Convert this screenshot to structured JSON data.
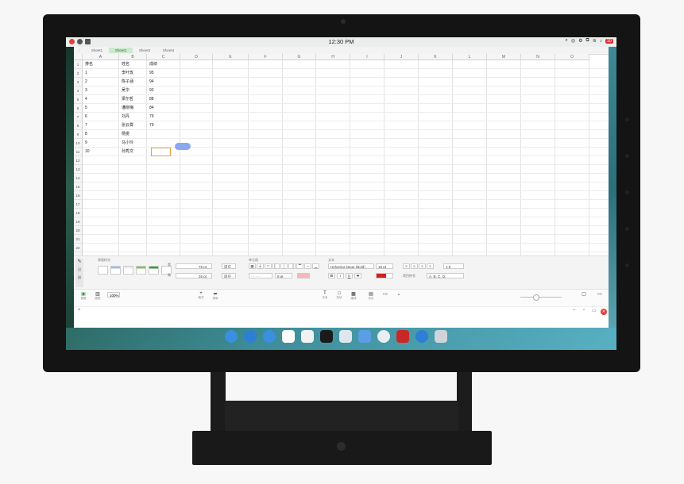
{
  "statusbar": {
    "time": "12:30 PM",
    "battery": "10"
  },
  "sheet_tabs": [
    "Sheet1",
    "Sheet2",
    "Sheet3",
    "Sheet4"
  ],
  "active_tab": 1,
  "columns": [
    "A",
    "B",
    "C",
    "D",
    "E",
    "F",
    "G",
    "H",
    "I",
    "J",
    "K",
    "L",
    "M",
    "N",
    "O"
  ],
  "rows": [
    "1",
    "2",
    "3",
    "4",
    "5",
    "6",
    "7",
    "8",
    "9",
    "10",
    "11",
    "12",
    "13",
    "14",
    "15",
    "16",
    "17",
    "18",
    "19",
    "20",
    "21",
    "22",
    "23"
  ],
  "cells": {
    "header": [
      "排名",
      "姓名",
      "成绩"
    ],
    "data": [
      [
        "1",
        "李叶玫",
        "95"
      ],
      [
        "2",
        "陈子涵",
        "94"
      ],
      [
        "3",
        "吴华",
        "93"
      ],
      [
        "4",
        "梁尔哲",
        "88"
      ],
      [
        "5",
        "潘晓梅",
        "84"
      ],
      [
        "6",
        "刘丹",
        "79"
      ],
      [
        "7",
        "张云霄",
        "79"
      ],
      [
        "8",
        "杨雯",
        ""
      ],
      [
        "9",
        "马小玲",
        ""
      ],
      [
        "10",
        "孙秀文",
        ""
      ]
    ]
  },
  "format_panel": {
    "table_style_title": "表格样式",
    "cell_title": "单元格",
    "text_title": "文本",
    "width_label": "宽",
    "width_value": "75 pt",
    "height_label": "高",
    "height_value": "26 pt",
    "fit_label": "适应",
    "border_size": "8 pt",
    "font_name": "Helvetica Neue (Bold)",
    "font_size": "16 pt",
    "bold": "B",
    "italic": "I",
    "underline": "U",
    "strike": "S",
    "line_spacing": "1.0",
    "list_label": "项目符号",
    "list_value": "A. B. C. D."
  },
  "toolbar": {
    "zoom": "100%",
    "items": [
      "表格",
      "图表",
      "文本",
      "形状",
      "媒体",
      "评论",
      "格式",
      "排序"
    ]
  },
  "colors": {
    "accent_green": "#3a9a3a",
    "close_red": "#e34040",
    "selection_orange": "#e0a050",
    "text_color_swatch": "#d62020"
  },
  "dock_icons": [
    "finder-icon",
    "browser-icon",
    "grid-icon",
    "mail-icon",
    "notes-icon",
    "music-icon",
    "photos-icon",
    "gallery-icon",
    "settings-icon",
    "store-icon",
    "calculator-icon",
    "trash-icon"
  ]
}
